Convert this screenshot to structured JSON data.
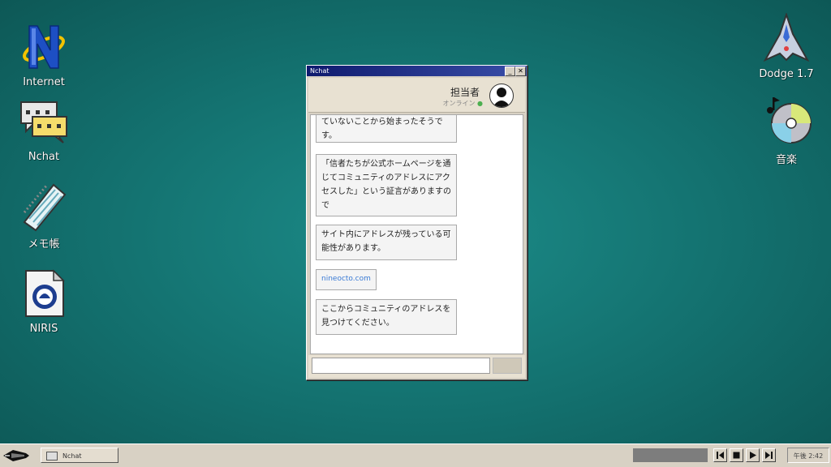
{
  "desktop": {
    "icons_left": [
      {
        "label": "Internet"
      },
      {
        "label": "Nchat"
      },
      {
        "label": "メモ帳"
      },
      {
        "label": "NIRIS"
      }
    ],
    "icons_right": [
      {
        "label": "Dodge 1.7"
      },
      {
        "label": "音楽"
      }
    ]
  },
  "chat_window": {
    "title": "Nchat",
    "minimize_label": "_",
    "close_label": "✕",
    "agent_name": "担当者",
    "agent_status": "オンライン",
    "status_dot": "●",
    "status_color": "#4caf50",
    "messages": [
      {
        "text": "ていないことから始まったそうです。"
      },
      {
        "text": "「信者たちが公式ホームページを通じてコミュニティのアドレスにアクセスした」という証言がありますので"
      },
      {
        "text": "サイト内にアドレスが残っている可能性があります。"
      },
      {
        "text": "nineocto.com"
      },
      {
        "text": "ここからコミュニティのアドレスを見つけてください。"
      }
    ],
    "input_placeholder": ""
  },
  "taskbar": {
    "task_item_label": "Nchat",
    "media_controls": [
      "previous-icon",
      "stop-icon",
      "play-icon",
      "next-icon"
    ],
    "clock": "午後 2:42"
  },
  "colors": {
    "desktop": "#13706e",
    "titlebar": "#0f1a6e",
    "link": "#3a7bd5"
  }
}
